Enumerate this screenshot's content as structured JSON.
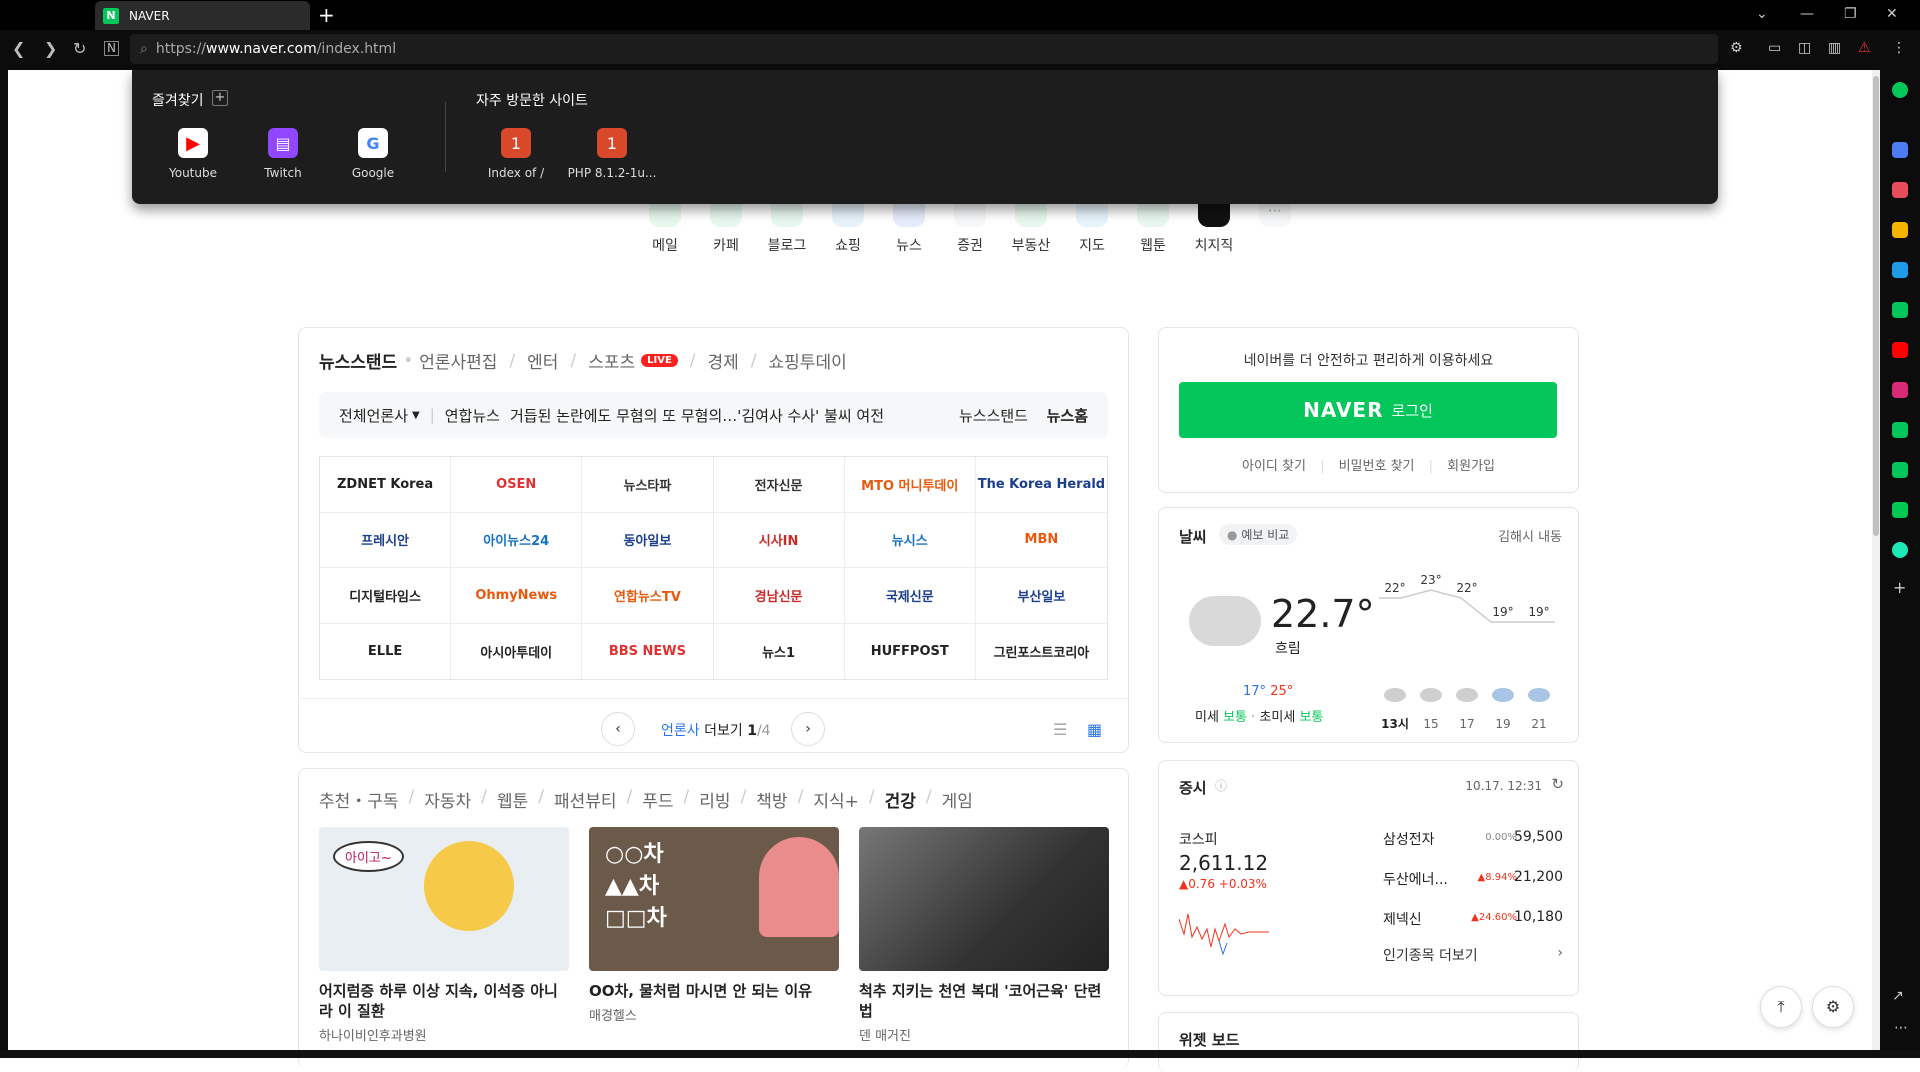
{
  "browser": {
    "tab_title": "NAVER",
    "url_prefix": "https://",
    "url_host": "www.naver.com",
    "url_path": "/index.html"
  },
  "dropdown": {
    "favorites_heading": "즐겨찾기",
    "frequent_heading": "자주 방문한 사이트",
    "favorites": [
      {
        "label": "Youtube"
      },
      {
        "label": "Twitch"
      },
      {
        "label": "Google"
      }
    ],
    "frequent": [
      {
        "label": "Index of /",
        "badge": "1"
      },
      {
        "label": "PHP 8.1.2-1u...",
        "badge": "1"
      }
    ]
  },
  "services": [
    {
      "label": "메일"
    },
    {
      "label": "카페"
    },
    {
      "label": "블로그"
    },
    {
      "label": "쇼핑"
    },
    {
      "label": "뉴스"
    },
    {
      "label": "증권"
    },
    {
      "label": "부동산"
    },
    {
      "label": "지도"
    },
    {
      "label": "웹툰"
    },
    {
      "label": "치지직"
    }
  ],
  "news": {
    "tabs": [
      "뉴스스탠드",
      "언론사편집",
      "엔터",
      "스포츠",
      "경제",
      "쇼핑투데이"
    ],
    "live_badge": "LIVE",
    "rolling_filter": "전체언론사",
    "rolling_source": "연합뉴스",
    "rolling_headline": "거듭된 논란에도 무혐의 또 무혐의…'김여사 수사' 불씨 여전",
    "link_standand": "뉴스스탠드",
    "link_home": "뉴스홈",
    "publishers": [
      "ZDNET Korea",
      "OSEN",
      "뉴스타파",
      "전자신문",
      "MTO 머니투데이",
      "The Korea Herald",
      "프레시안",
      "아이뉴스24",
      "동아일보",
      "시사IN",
      "뉴시스",
      "MBN",
      "디지털타임스",
      "OhmyNews",
      "연합뉴스TV",
      "경남신문",
      "국제신문",
      "부산일보",
      "ELLE",
      "아시아투데이",
      "BBS NEWS",
      "뉴스1",
      "HUFFPOST",
      "그린포스트코리아"
    ],
    "more_label_1": "언론사",
    "more_label_2": "더보기",
    "page_current": "1",
    "page_total": "/4"
  },
  "theme": {
    "tabs": [
      "추천・구독",
      "자동차",
      "웹툰",
      "패션뷰티",
      "푸드",
      "리빙",
      "책방",
      "지식+",
      "건강",
      "게임"
    ],
    "articles": [
      {
        "title": "어지럼증 하루 이상 지속, 이석증 아니라 이 질환",
        "source": "하나이비인후과병원",
        "img_text": "아이고~"
      },
      {
        "title": "OO차, 물처럼 마시면 안 되는 이유",
        "source": "매경헬스",
        "img_text": "○○차 ▲▲차 □□차"
      },
      {
        "title": "척추 지키는 천연 복대 '코어근육' 단련법",
        "source": "덴 매거진",
        "img_text": ""
      }
    ]
  },
  "login": {
    "prompt": "네이버를 더 안전하고 편리하게 이용하세요",
    "logo": "NAVER",
    "button": "로그인",
    "find_id": "아이디 찾기",
    "find_pw": "비밀번호 찾기",
    "signup": "회원가입"
  },
  "weather": {
    "title": "날씨",
    "compare": "예보 비교",
    "location": "김해시 내동",
    "temp": "22.7°",
    "condition": "흐림",
    "low": "17°",
    "high": "25°",
    "dust_label": "미세",
    "dust_value": "보통",
    "ultra_label": "초미세",
    "ultra_value": "보통",
    "hourly_temps": [
      "22°",
      "23°",
      "22°",
      "19°",
      "19°"
    ],
    "hourly_times": [
      "13시",
      "15",
      "17",
      "19",
      "21"
    ]
  },
  "stock": {
    "title": "증시",
    "time": "10.17. 12:31",
    "kospi_label": "코스피",
    "kospi_value": "2,611.12",
    "kospi_change": "▲0.76 +0.03%",
    "items": [
      {
        "name": "삼성전자",
        "change": "0.00%",
        "price": "59,500"
      },
      {
        "name": "두산에너...",
        "change": "▲8.94%",
        "price": "21,200"
      },
      {
        "name": "제넥신",
        "change": "▲24.60%",
        "price": "10,180"
      }
    ],
    "more": "인기종목 더보기"
  },
  "widget": {
    "title": "위젯 보드"
  },
  "colors": {
    "naver_green": "#03c75a",
    "up_red": "#f0331c",
    "down_blue": "#2a74e8"
  }
}
